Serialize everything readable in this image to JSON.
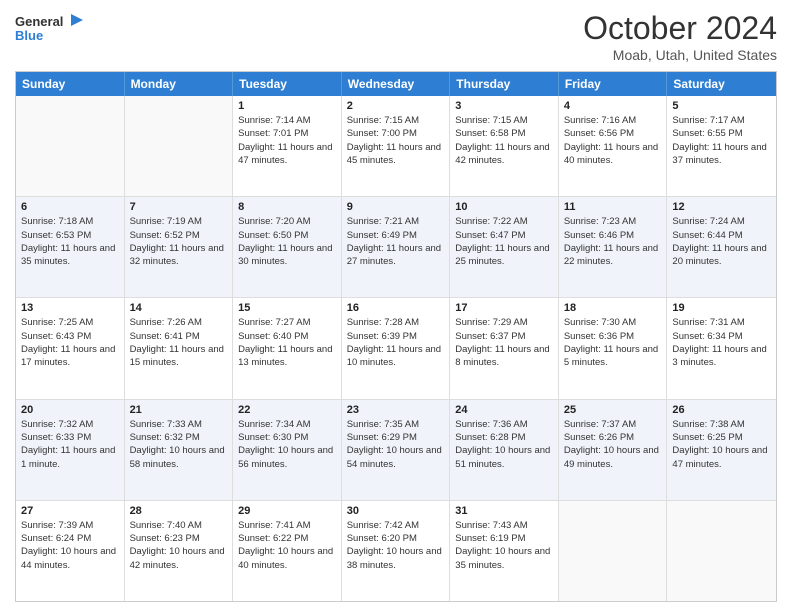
{
  "logo": {
    "line1": "General",
    "line2": "Blue"
  },
  "title": "October 2024",
  "subtitle": "Moab, Utah, United States",
  "days": [
    "Sunday",
    "Monday",
    "Tuesday",
    "Wednesday",
    "Thursday",
    "Friday",
    "Saturday"
  ],
  "rows": [
    [
      {
        "day": "",
        "info": ""
      },
      {
        "day": "",
        "info": ""
      },
      {
        "day": "1",
        "info": "Sunrise: 7:14 AM\nSunset: 7:01 PM\nDaylight: 11 hours and 47 minutes."
      },
      {
        "day": "2",
        "info": "Sunrise: 7:15 AM\nSunset: 7:00 PM\nDaylight: 11 hours and 45 minutes."
      },
      {
        "day": "3",
        "info": "Sunrise: 7:15 AM\nSunset: 6:58 PM\nDaylight: 11 hours and 42 minutes."
      },
      {
        "day": "4",
        "info": "Sunrise: 7:16 AM\nSunset: 6:56 PM\nDaylight: 11 hours and 40 minutes."
      },
      {
        "day": "5",
        "info": "Sunrise: 7:17 AM\nSunset: 6:55 PM\nDaylight: 11 hours and 37 minutes."
      }
    ],
    [
      {
        "day": "6",
        "info": "Sunrise: 7:18 AM\nSunset: 6:53 PM\nDaylight: 11 hours and 35 minutes."
      },
      {
        "day": "7",
        "info": "Sunrise: 7:19 AM\nSunset: 6:52 PM\nDaylight: 11 hours and 32 minutes."
      },
      {
        "day": "8",
        "info": "Sunrise: 7:20 AM\nSunset: 6:50 PM\nDaylight: 11 hours and 30 minutes."
      },
      {
        "day": "9",
        "info": "Sunrise: 7:21 AM\nSunset: 6:49 PM\nDaylight: 11 hours and 27 minutes."
      },
      {
        "day": "10",
        "info": "Sunrise: 7:22 AM\nSunset: 6:47 PM\nDaylight: 11 hours and 25 minutes."
      },
      {
        "day": "11",
        "info": "Sunrise: 7:23 AM\nSunset: 6:46 PM\nDaylight: 11 hours and 22 minutes."
      },
      {
        "day": "12",
        "info": "Sunrise: 7:24 AM\nSunset: 6:44 PM\nDaylight: 11 hours and 20 minutes."
      }
    ],
    [
      {
        "day": "13",
        "info": "Sunrise: 7:25 AM\nSunset: 6:43 PM\nDaylight: 11 hours and 17 minutes."
      },
      {
        "day": "14",
        "info": "Sunrise: 7:26 AM\nSunset: 6:41 PM\nDaylight: 11 hours and 15 minutes."
      },
      {
        "day": "15",
        "info": "Sunrise: 7:27 AM\nSunset: 6:40 PM\nDaylight: 11 hours and 13 minutes."
      },
      {
        "day": "16",
        "info": "Sunrise: 7:28 AM\nSunset: 6:39 PM\nDaylight: 11 hours and 10 minutes."
      },
      {
        "day": "17",
        "info": "Sunrise: 7:29 AM\nSunset: 6:37 PM\nDaylight: 11 hours and 8 minutes."
      },
      {
        "day": "18",
        "info": "Sunrise: 7:30 AM\nSunset: 6:36 PM\nDaylight: 11 hours and 5 minutes."
      },
      {
        "day": "19",
        "info": "Sunrise: 7:31 AM\nSunset: 6:34 PM\nDaylight: 11 hours and 3 minutes."
      }
    ],
    [
      {
        "day": "20",
        "info": "Sunrise: 7:32 AM\nSunset: 6:33 PM\nDaylight: 11 hours and 1 minute."
      },
      {
        "day": "21",
        "info": "Sunrise: 7:33 AM\nSunset: 6:32 PM\nDaylight: 10 hours and 58 minutes."
      },
      {
        "day": "22",
        "info": "Sunrise: 7:34 AM\nSunset: 6:30 PM\nDaylight: 10 hours and 56 minutes."
      },
      {
        "day": "23",
        "info": "Sunrise: 7:35 AM\nSunset: 6:29 PM\nDaylight: 10 hours and 54 minutes."
      },
      {
        "day": "24",
        "info": "Sunrise: 7:36 AM\nSunset: 6:28 PM\nDaylight: 10 hours and 51 minutes."
      },
      {
        "day": "25",
        "info": "Sunrise: 7:37 AM\nSunset: 6:26 PM\nDaylight: 10 hours and 49 minutes."
      },
      {
        "day": "26",
        "info": "Sunrise: 7:38 AM\nSunset: 6:25 PM\nDaylight: 10 hours and 47 minutes."
      }
    ],
    [
      {
        "day": "27",
        "info": "Sunrise: 7:39 AM\nSunset: 6:24 PM\nDaylight: 10 hours and 44 minutes."
      },
      {
        "day": "28",
        "info": "Sunrise: 7:40 AM\nSunset: 6:23 PM\nDaylight: 10 hours and 42 minutes."
      },
      {
        "day": "29",
        "info": "Sunrise: 7:41 AM\nSunset: 6:22 PM\nDaylight: 10 hours and 40 minutes."
      },
      {
        "day": "30",
        "info": "Sunrise: 7:42 AM\nSunset: 6:20 PM\nDaylight: 10 hours and 38 minutes."
      },
      {
        "day": "31",
        "info": "Sunrise: 7:43 AM\nSunset: 6:19 PM\nDaylight: 10 hours and 35 minutes."
      },
      {
        "day": "",
        "info": ""
      },
      {
        "day": "",
        "info": ""
      }
    ]
  ]
}
